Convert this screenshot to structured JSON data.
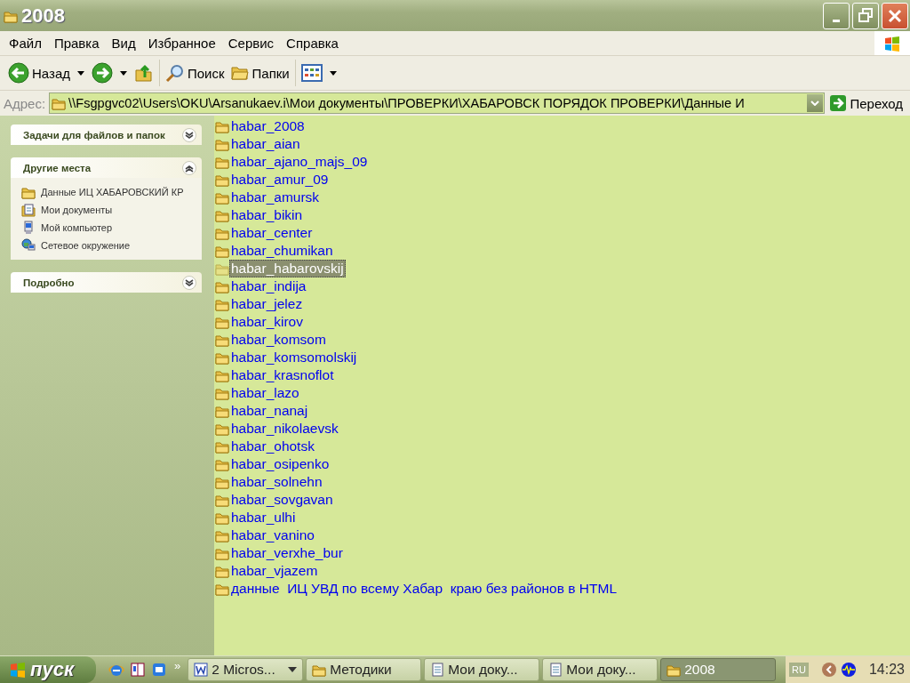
{
  "window": {
    "title": "2008"
  },
  "menu": [
    "Файл",
    "Правка",
    "Вид",
    "Избранное",
    "Сервис",
    "Справка"
  ],
  "toolbar": [
    {
      "kind": "back",
      "label": "Назад",
      "dropdown": true
    },
    {
      "kind": "forward",
      "dropdown": true
    },
    {
      "kind": "up"
    },
    {
      "kind": "search",
      "label": "Поиск"
    },
    {
      "kind": "folders",
      "label": "Папки"
    },
    {
      "kind": "views",
      "dropdown": true
    }
  ],
  "address": {
    "label": "Адрес:",
    "value": "\\\\Fsgpgvc02\\Users\\OKU\\Arsanukaev.i\\Мои документы\\ПРОВЕРКИ\\ХАБАРОВСК ПОРЯДОК ПРОВЕРКИ\\Данные И",
    "go": "Переход"
  },
  "sidebar": [
    {
      "title": "Задачи для файлов и папок",
      "expanded": false
    },
    {
      "title": "Другие места",
      "expanded": true,
      "items": [
        {
          "kind": "folder",
          "label": "Данные ИЦ ХАБАРОВСКИЙ КР"
        },
        {
          "kind": "documents",
          "label": "Мои документы"
        },
        {
          "kind": "computer",
          "label": "Мой компьютер"
        },
        {
          "kind": "network",
          "label": "Сетевое окружение"
        }
      ]
    },
    {
      "title": "Подробно",
      "expanded": false
    }
  ],
  "files": [
    {
      "name": "habar_2008",
      "selected": false
    },
    {
      "name": "habar_aian",
      "selected": false
    },
    {
      "name": "habar_ajano_majs_09",
      "selected": false
    },
    {
      "name": "habar_amur_09",
      "selected": false
    },
    {
      "name": "habar_amursk",
      "selected": false
    },
    {
      "name": "habar_bikin",
      "selected": false
    },
    {
      "name": "habar_center",
      "selected": false
    },
    {
      "name": "habar_chumikan",
      "selected": false
    },
    {
      "name": "habar_habarovskij",
      "selected": true
    },
    {
      "name": "habar_indija",
      "selected": false
    },
    {
      "name": "habar_jelez",
      "selected": false
    },
    {
      "name": "habar_kirov",
      "selected": false
    },
    {
      "name": "habar_komsom",
      "selected": false
    },
    {
      "name": "habar_komsomolskij",
      "selected": false
    },
    {
      "name": "habar_krasnoflot",
      "selected": false
    },
    {
      "name": "habar_lazo",
      "selected": false
    },
    {
      "name": "habar_nanaj",
      "selected": false
    },
    {
      "name": "habar_nikolaevsk",
      "selected": false
    },
    {
      "name": "habar_ohotsk",
      "selected": false
    },
    {
      "name": "habar_osipenko",
      "selected": false
    },
    {
      "name": "habar_solnehn",
      "selected": false
    },
    {
      "name": "habar_sovgavan",
      "selected": false
    },
    {
      "name": "habar_ulhi",
      "selected": false
    },
    {
      "name": "habar_vanino",
      "selected": false
    },
    {
      "name": "habar_verxhe_bur",
      "selected": false
    },
    {
      "name": "habar_vjazem",
      "selected": false
    },
    {
      "name": "данные  ИЦ УВД по всему Хабар  краю без районов в HTML",
      "selected": false
    }
  ],
  "taskbar": {
    "start": "пуск",
    "quick_launch": [
      {
        "kind": "browser"
      },
      {
        "kind": "book"
      },
      {
        "kind": "mail"
      }
    ],
    "more": "»",
    "tasks": [
      {
        "kind": "word",
        "label": "2 Micros...",
        "selected": false,
        "dropdown": true
      },
      {
        "kind": "folder",
        "label": "Методики",
        "selected": false,
        "dropdown": false
      },
      {
        "kind": "document",
        "label": "Мои доку...",
        "selected": false,
        "dropdown": false
      },
      {
        "kind": "document",
        "label": "Мои доку...",
        "selected": false,
        "dropdown": false
      },
      {
        "kind": "folder",
        "label": "2008",
        "selected": true,
        "dropdown": false
      }
    ],
    "language": "RU",
    "clock": "14:23"
  }
}
